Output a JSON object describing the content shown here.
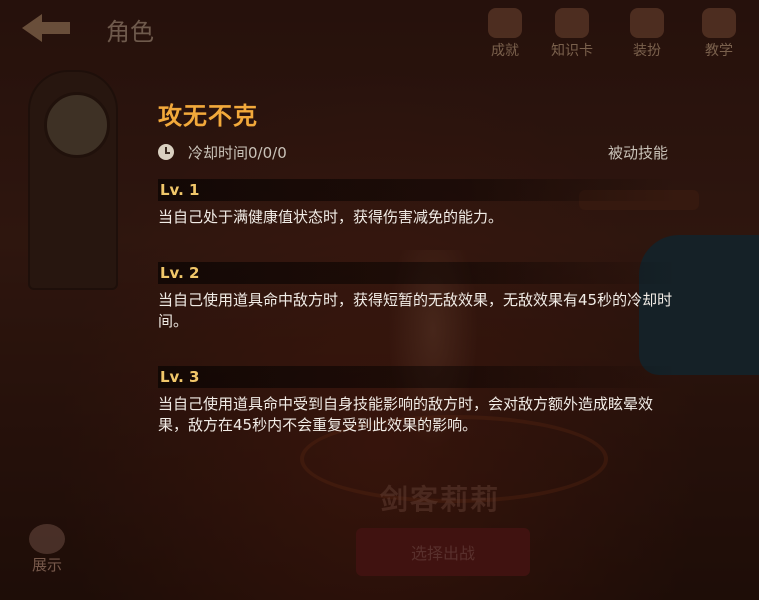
{
  "topbar": {
    "title": "角色",
    "nav": [
      {
        "label": "成就",
        "icon": "trophy-icon"
      },
      {
        "label": "知识卡",
        "icon": "card-icon"
      },
      {
        "label": "装扮",
        "icon": "wardrobe-icon"
      },
      {
        "label": "教学",
        "icon": "book-icon"
      }
    ]
  },
  "character": {
    "name": "剑客莉莉",
    "select_label": "选择出战"
  },
  "show_label": "展示",
  "skill": {
    "name": "攻无不克",
    "cooldown": "冷却时间0/0/0",
    "type": "被动技能",
    "levels": [
      {
        "label": "Lv. 1",
        "desc": "当自己处于满健康值状态时，获得伤害减免的能力。"
      },
      {
        "label": "Lv. 2",
        "desc": "当自己使用道具命中敌方时，获得短暂的无敌效果，无敌效果有45秒的冷却时间。"
      },
      {
        "label": "Lv. 3",
        "desc": "当自己使用道具命中受到自身技能影响的敌方时，会对敌方额外造成眩晕效果，敌方在45秒内不会重复受到此效果的影响。"
      }
    ]
  },
  "colors": {
    "accent": "#f2a93b",
    "level": "#f1c76a",
    "text": "#f1ece6"
  }
}
